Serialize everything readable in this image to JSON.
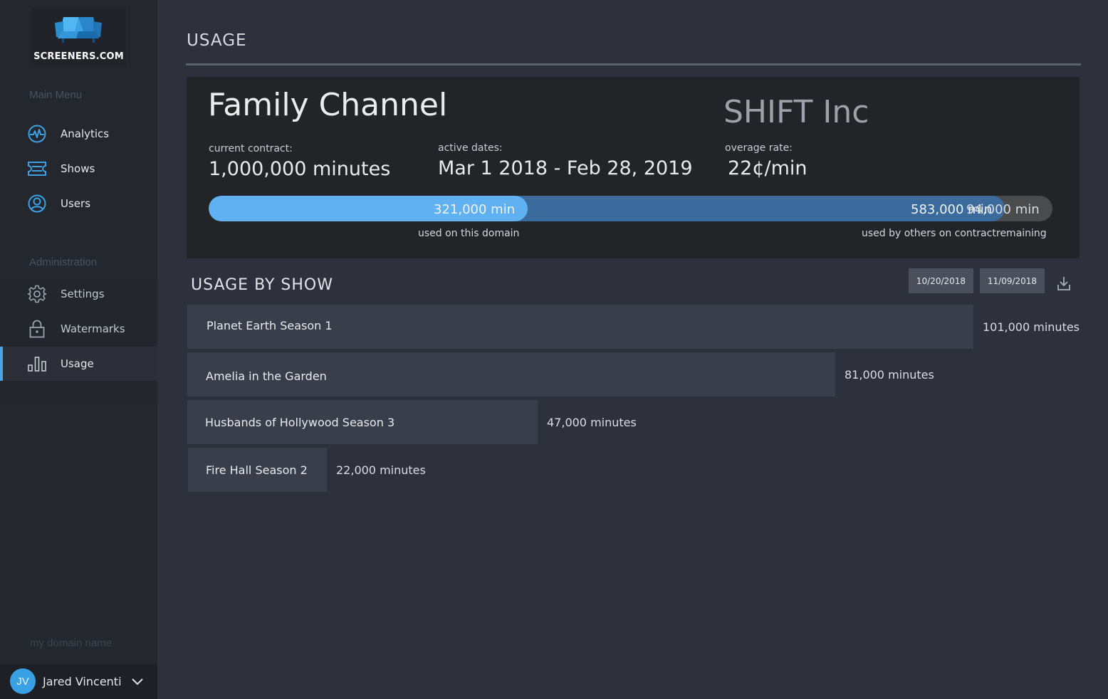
{
  "brand": {
    "name": "SCREENERS.COM"
  },
  "sidebar": {
    "main_menu_label": "Main Menu",
    "main_items": [
      {
        "label": "Analytics",
        "icon": "activity-icon"
      },
      {
        "label": "Shows",
        "icon": "ticket-icon"
      },
      {
        "label": "Users",
        "icon": "user-circle-icon"
      }
    ],
    "admin_label": "Administration",
    "admin_items": [
      {
        "label": "Settings",
        "icon": "gear-icon"
      },
      {
        "label": "Watermarks",
        "icon": "lock-icon"
      },
      {
        "label": "Usage",
        "icon": "bar-chart-icon",
        "active": true
      }
    ],
    "domain_placeholder": "my domain name",
    "user": {
      "initials": "JV",
      "name": "Jared Vincenti"
    }
  },
  "page": {
    "title": "USAGE"
  },
  "contract": {
    "channel": "Family Channel",
    "company": "SHIFT Inc",
    "current_contract_label": "current contract:",
    "current_contract_value": "1,000,000 minutes",
    "active_dates_label": "active dates:",
    "active_dates_value": "Mar 1 2018 - Feb 28, 2019",
    "overage_label": "overage rate:",
    "overage_value": "22¢/min",
    "usage": {
      "total_minutes": 1000000,
      "domain": {
        "minutes": 321000,
        "text": "321,000 min",
        "caption": "used on this domain"
      },
      "others": {
        "minutes": 583000,
        "text": "583,000 min",
        "caption": "used by others on contract"
      },
      "remaining": {
        "minutes": 94000,
        "text": "94,000 min",
        "caption": "remaining"
      }
    },
    "colors": {
      "domain": "#5fb1f2",
      "others": "#3a6b9c",
      "remaining": "#4a4b4d"
    }
  },
  "usage_by_show": {
    "title": "USAGE BY SHOW",
    "date_from": "10/20/2018",
    "date_to": "11/09/2018",
    "download_icon": "download-icon",
    "shows": [
      {
        "name": "Planet Earth Season 1",
        "minutes": 101000,
        "label": "101,000 minutes"
      },
      {
        "name": "Amelia in the Garden",
        "minutes": 81000,
        "label": "81,000 minutes"
      },
      {
        "name": "Husbands of Hollywood Season 3",
        "minutes": 47000,
        "label": "47,000 minutes"
      },
      {
        "name": "Fire Hall Season 2",
        "minutes": 22000,
        "label": "22,000 minutes"
      }
    ]
  }
}
